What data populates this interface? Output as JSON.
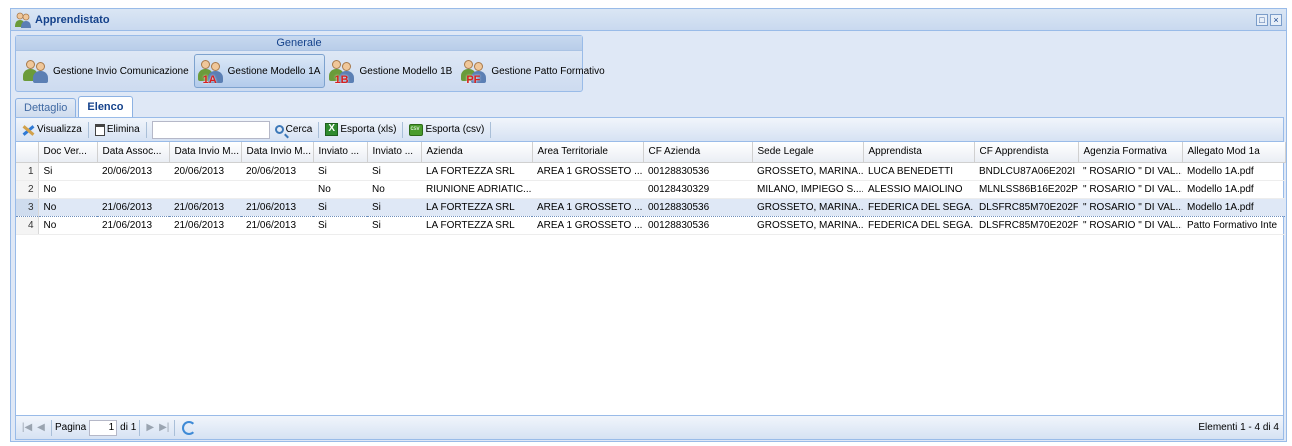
{
  "window": {
    "title": "Apprendistato"
  },
  "ribbon": {
    "group_title": "Generale",
    "buttons": [
      {
        "label": "Gestione Invio Comunicazione",
        "badge": ""
      },
      {
        "label": "Gestione Modello 1A",
        "badge": "1A"
      },
      {
        "label": "Gestione Modello 1B",
        "badge": "1B"
      },
      {
        "label": "Gestione Patto Formativo",
        "badge": "PF"
      }
    ]
  },
  "tabs": [
    {
      "label": "Dettaglio"
    },
    {
      "label": "Elenco"
    }
  ],
  "toolbar": {
    "view_label": "Visualizza",
    "delete_label": "Elimina",
    "search_value": "",
    "search_label": "Cerca",
    "export_xls_label": "Esporta (xls)",
    "export_csv_label": "Esporta (csv)"
  },
  "grid": {
    "columns": [
      "Doc Ver...",
      "Data Assoc...",
      "Data Invio M...",
      "Data Invio M...",
      "Inviato ...",
      "Inviato ...",
      "Azienda",
      "Area Territoriale",
      "CF Azienda",
      "Sede Legale",
      "Apprendista",
      "CF Apprendista",
      "Agenzia Formativa",
      "Allegato Mod 1a"
    ],
    "rows": [
      {
        "n": "1",
        "cells": [
          "Si",
          "20/06/2013",
          "20/06/2013",
          "20/06/2013",
          "Si",
          "Si",
          "LA FORTEZZA SRL",
          "AREA 1 GROSSETO ...",
          "00128830536",
          "GROSSETO, MARINA...",
          "LUCA BENEDETTI",
          "BNDLCU87A06E202I",
          "\" ROSARIO \" DI VAL...",
          "Modello 1A.pdf"
        ]
      },
      {
        "n": "2",
        "cells": [
          "No",
          "",
          "",
          "",
          "No",
          "No",
          "RIUNIONE ADRIATIC...",
          "",
          "00128430329",
          "MILANO, IMPIEGO S....",
          "ALESSIO MAIOLINO",
          "MLNLSS86B16E202P",
          "\" ROSARIO \" DI VAL...",
          "Modello 1A.pdf"
        ]
      },
      {
        "n": "3",
        "cells": [
          "No",
          "21/06/2013",
          "21/06/2013",
          "21/06/2013",
          "Si",
          "Si",
          "LA FORTEZZA SRL",
          "AREA 1 GROSSETO ...",
          "00128830536",
          "GROSSETO, MARINA...",
          "FEDERICA DEL SEGA...",
          "DLSFRC85M70E202F",
          "\" ROSARIO \" DI VAL...",
          "Modello 1A.pdf"
        ]
      },
      {
        "n": "4",
        "cells": [
          "No",
          "21/06/2013",
          "21/06/2013",
          "21/06/2013",
          "Si",
          "Si",
          "LA FORTEZZA SRL",
          "AREA 1 GROSSETO ...",
          "00128830536",
          "GROSSETO, MARINA...",
          "FEDERICA DEL SEGA...",
          "DLSFRC85M70E202F",
          "\" ROSARIO \" DI VAL...",
          "Patto Formativo Inte"
        ]
      }
    ]
  },
  "pager": {
    "page_label": "Pagina",
    "page_value": "1",
    "of_label": "di 1",
    "info": "Elementi 1 - 4 di 4"
  }
}
